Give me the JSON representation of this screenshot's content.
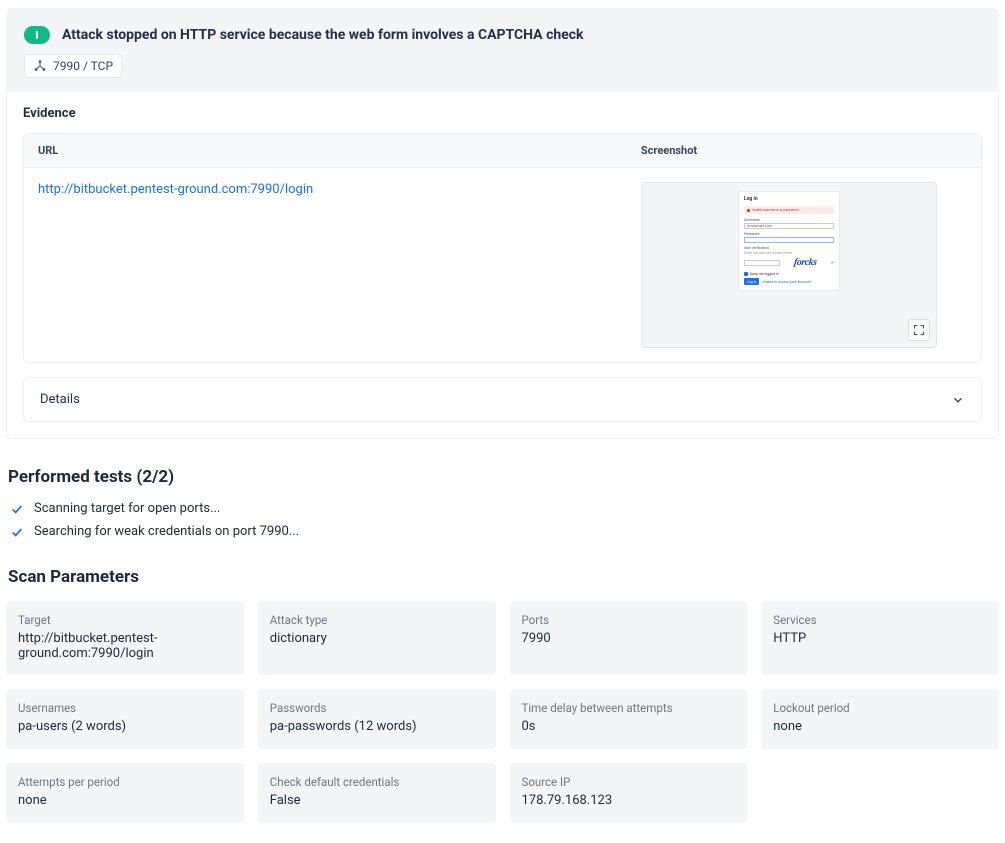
{
  "finding": {
    "title": "Attack stopped on HTTP service because the web form involves a CAPTCHA check",
    "port_chip": "7990 / TCP"
  },
  "evidence": {
    "heading": "Evidence",
    "columns": {
      "url": "URL",
      "screenshot": "Screenshot"
    },
    "url": "http://bitbucket.pentest-ground.com:7990/login",
    "screenshot_login": {
      "title": "Log in",
      "error": "Invalid username or password.",
      "label_username": "Username",
      "value_username": "benchmark-user",
      "label_password": "Password",
      "label_verification": "User verification",
      "hint_verification": "Enter the word as shown below",
      "captcha_word": "forcks",
      "remember": "Keep me logged in",
      "login_btn": "Log in",
      "forgot": "Unable to access your account?"
    }
  },
  "details": {
    "label": "Details"
  },
  "performed_tests": {
    "heading": "Performed tests (2/2)",
    "items": [
      "Scanning target for open ports...",
      "Searching for weak credentials on port 7990..."
    ]
  },
  "scan_parameters": {
    "heading": "Scan Parameters",
    "items": [
      {
        "label": "Target",
        "value": "http://bitbucket.pentest-ground.com:7990/login"
      },
      {
        "label": "Attack type",
        "value": "dictionary"
      },
      {
        "label": "Ports",
        "value": "7990"
      },
      {
        "label": "Services",
        "value": "HTTP"
      },
      {
        "label": "Usernames",
        "value": "pa-users (2 words)"
      },
      {
        "label": "Passwords",
        "value": "pa-passwords (12 words)"
      },
      {
        "label": "Time delay between attempts",
        "value": "0s"
      },
      {
        "label": "Lockout period",
        "value": "none"
      },
      {
        "label": "Attempts per period",
        "value": "none"
      },
      {
        "label": "Check default credentials",
        "value": "False"
      },
      {
        "label": "Source IP",
        "value": "178.79.168.123"
      }
    ]
  }
}
